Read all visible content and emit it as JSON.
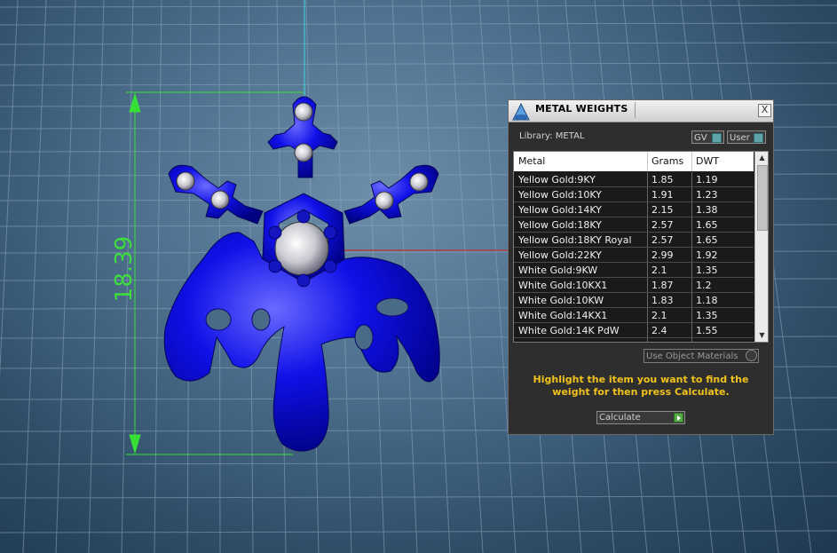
{
  "viewport": {
    "dimension_value": "18.39"
  },
  "panel": {
    "title": "METAL WEIGHTS",
    "close_label": "X",
    "library_label": "Library: METAL",
    "toggles": {
      "gv": "GV",
      "user": "User"
    },
    "table": {
      "columns": [
        "Metal",
        "Grams",
        "DWT"
      ],
      "rows": [
        [
          "Yellow Gold:9KY",
          "1.85",
          "1.19"
        ],
        [
          "Yellow Gold:10KY",
          "1.91",
          "1.23"
        ],
        [
          "Yellow Gold:14KY",
          "2.15",
          "1.38"
        ],
        [
          "Yellow Gold:18KY",
          "2.57",
          "1.65"
        ],
        [
          "Yellow Gold:18KY Royal",
          "2.57",
          "1.65"
        ],
        [
          "Yellow Gold:22KY",
          "2.99",
          "1.92"
        ],
        [
          "White Gold:9KW",
          "2.1",
          "1.35"
        ],
        [
          "White Gold:10KX1",
          "1.87",
          "1.2"
        ],
        [
          "White Gold:10KW",
          "1.83",
          "1.18"
        ],
        [
          "White Gold:14KX1",
          "2.1",
          "1.35"
        ],
        [
          "White Gold:14K PdW",
          "2.4",
          "1.55"
        ]
      ]
    },
    "use_object_materials": "Use Object Materials",
    "instruction": "Highlight the item you want to find the weight for then press Calculate.",
    "calculate_label": "Calculate"
  }
}
